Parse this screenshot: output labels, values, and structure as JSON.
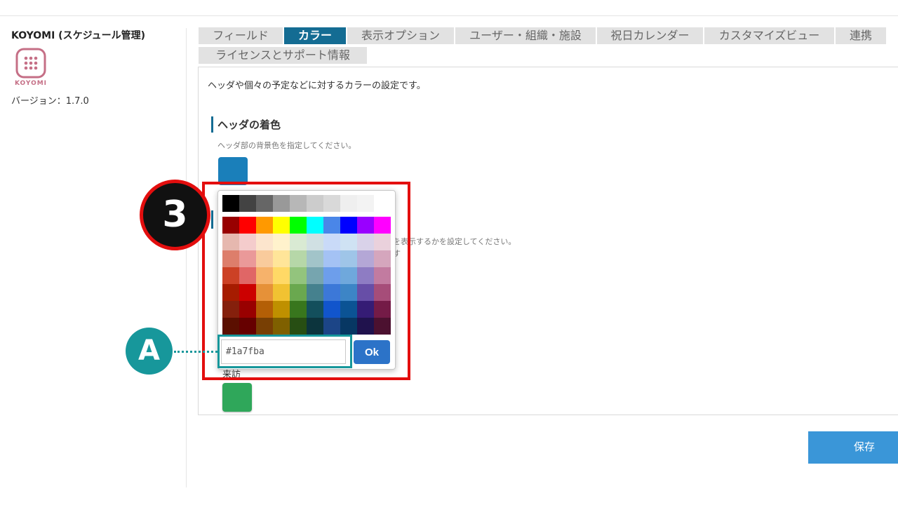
{
  "sidebar": {
    "app_title": "KOYOMI (スケジュール管理)",
    "logo_text": "KOYOMI",
    "version": "バージョン：1.7.0"
  },
  "tabs": [
    {
      "label": "フィールド",
      "active": false
    },
    {
      "label": "カラー",
      "active": true
    },
    {
      "label": "表示オプション",
      "active": false
    },
    {
      "label": "ユーザー・組織・施設",
      "active": false
    },
    {
      "label": "祝日カレンダー",
      "active": false
    },
    {
      "label": "カスタマイズビュー",
      "active": false
    },
    {
      "label": "連携",
      "active": false
    },
    {
      "label": "ライセンスとサポート情報",
      "active": false
    }
  ],
  "content": {
    "description": "ヘッダや個々の予定などに対するカラーの設定です。",
    "header_section": {
      "title": "ヘッダの着色",
      "description": "ヘッダ部の背景色を指定してください。",
      "color": "#1a7fba"
    },
    "obscured_text_1": "を表示するかを設定してください。",
    "obscured_text_2": "す",
    "visit_label": "来訪",
    "visit_color": "#2fa75a"
  },
  "color_picker": {
    "gray_row": [
      "#000000",
      "#434343",
      "#666666",
      "#999999",
      "#b7b7b7",
      "#cccccc",
      "#d9d9d9",
      "#efefef",
      "#f3f3f3",
      "#ffffff"
    ],
    "grid": [
      [
        "#980000",
        "#ff0000",
        "#ff9900",
        "#ffff00",
        "#00ff00",
        "#00ffff",
        "#4a86e8",
        "#0000ff",
        "#9900ff",
        "#ff00ff"
      ],
      [
        "#e6b8af",
        "#f4cccc",
        "#fce5cd",
        "#fff2cc",
        "#d9ead3",
        "#d0e0e3",
        "#c9daf8",
        "#cfe2f3",
        "#d9d2e9",
        "#ead1dc"
      ],
      [
        "#dd7e6b",
        "#ea9999",
        "#f9cb9c",
        "#ffe599",
        "#b6d7a8",
        "#a2c4c9",
        "#a4c2f4",
        "#9fc5e8",
        "#b4a7d6",
        "#d5a6bd"
      ],
      [
        "#cc4125",
        "#e06666",
        "#f6b26b",
        "#ffd966",
        "#93c47d",
        "#76a5af",
        "#6d9eeb",
        "#6fa8dc",
        "#8e7cc3",
        "#c27ba0"
      ],
      [
        "#a61c00",
        "#cc0000",
        "#e69138",
        "#f1c232",
        "#6aa84f",
        "#45818e",
        "#3c78d8",
        "#3d85c6",
        "#674ea7",
        "#a64d79"
      ],
      [
        "#85200c",
        "#990000",
        "#b45f06",
        "#bf9000",
        "#38761d",
        "#134f5c",
        "#1155cc",
        "#0b5394",
        "#351c75",
        "#741b47"
      ],
      [
        "#5b0f00",
        "#660000",
        "#783f04",
        "#7f6000",
        "#274e13",
        "#0c343d",
        "#1c4587",
        "#073763",
        "#20124d",
        "#4c1130"
      ]
    ],
    "hex_value": "#1a7fba",
    "ok_label": "Ok"
  },
  "annotations": {
    "step_number": "3",
    "callout_label": "A"
  },
  "footer": {
    "save_label": "保存"
  }
}
